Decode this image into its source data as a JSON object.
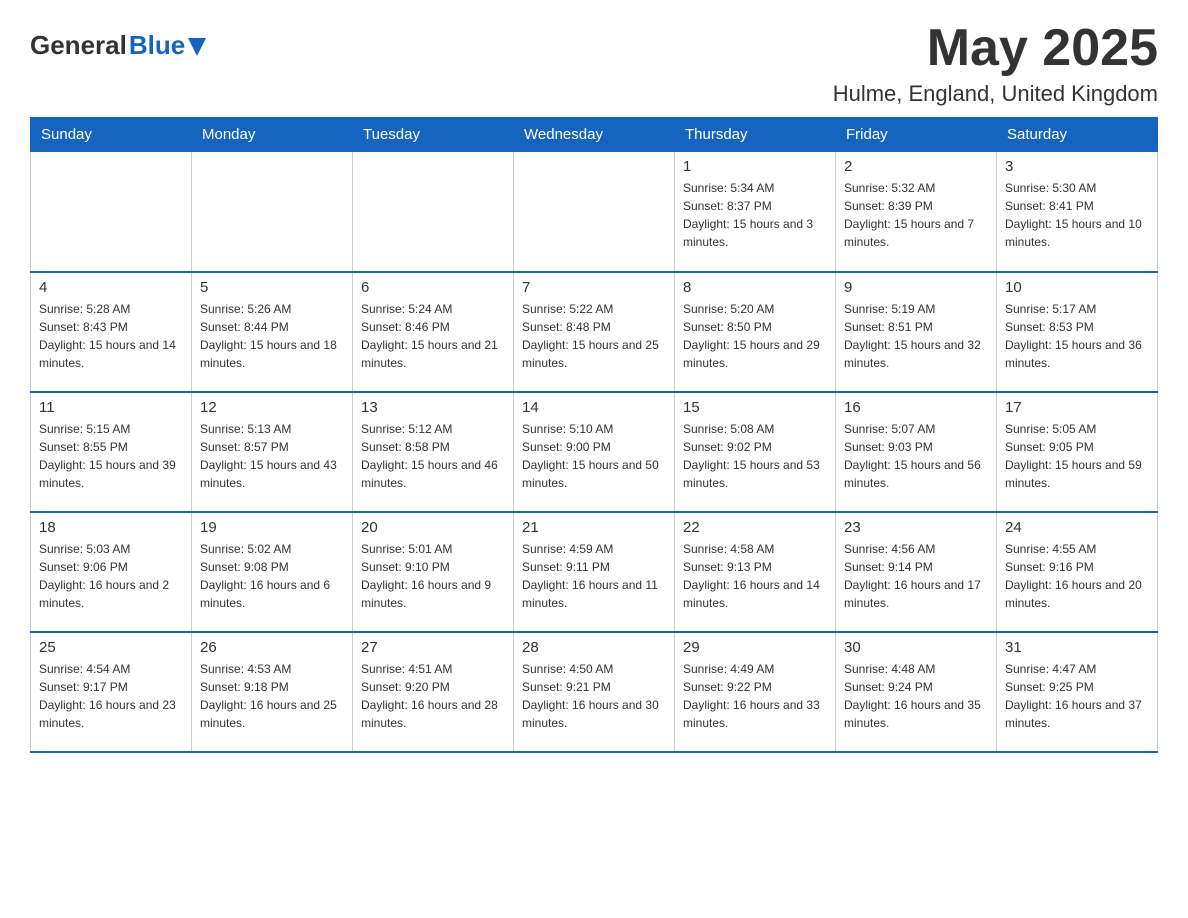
{
  "header": {
    "logo_general": "General",
    "logo_blue": "Blue",
    "title": "May 2025",
    "location": "Hulme, England, United Kingdom"
  },
  "weekdays": [
    "Sunday",
    "Monday",
    "Tuesday",
    "Wednesday",
    "Thursday",
    "Friday",
    "Saturday"
  ],
  "weeks": [
    [
      {
        "day": "",
        "info": ""
      },
      {
        "day": "",
        "info": ""
      },
      {
        "day": "",
        "info": ""
      },
      {
        "day": "",
        "info": ""
      },
      {
        "day": "1",
        "info": "Sunrise: 5:34 AM\nSunset: 8:37 PM\nDaylight: 15 hours and 3 minutes."
      },
      {
        "day": "2",
        "info": "Sunrise: 5:32 AM\nSunset: 8:39 PM\nDaylight: 15 hours and 7 minutes."
      },
      {
        "day": "3",
        "info": "Sunrise: 5:30 AM\nSunset: 8:41 PM\nDaylight: 15 hours and 10 minutes."
      }
    ],
    [
      {
        "day": "4",
        "info": "Sunrise: 5:28 AM\nSunset: 8:43 PM\nDaylight: 15 hours and 14 minutes."
      },
      {
        "day": "5",
        "info": "Sunrise: 5:26 AM\nSunset: 8:44 PM\nDaylight: 15 hours and 18 minutes."
      },
      {
        "day": "6",
        "info": "Sunrise: 5:24 AM\nSunset: 8:46 PM\nDaylight: 15 hours and 21 minutes."
      },
      {
        "day": "7",
        "info": "Sunrise: 5:22 AM\nSunset: 8:48 PM\nDaylight: 15 hours and 25 minutes."
      },
      {
        "day": "8",
        "info": "Sunrise: 5:20 AM\nSunset: 8:50 PM\nDaylight: 15 hours and 29 minutes."
      },
      {
        "day": "9",
        "info": "Sunrise: 5:19 AM\nSunset: 8:51 PM\nDaylight: 15 hours and 32 minutes."
      },
      {
        "day": "10",
        "info": "Sunrise: 5:17 AM\nSunset: 8:53 PM\nDaylight: 15 hours and 36 minutes."
      }
    ],
    [
      {
        "day": "11",
        "info": "Sunrise: 5:15 AM\nSunset: 8:55 PM\nDaylight: 15 hours and 39 minutes."
      },
      {
        "day": "12",
        "info": "Sunrise: 5:13 AM\nSunset: 8:57 PM\nDaylight: 15 hours and 43 minutes."
      },
      {
        "day": "13",
        "info": "Sunrise: 5:12 AM\nSunset: 8:58 PM\nDaylight: 15 hours and 46 minutes."
      },
      {
        "day": "14",
        "info": "Sunrise: 5:10 AM\nSunset: 9:00 PM\nDaylight: 15 hours and 50 minutes."
      },
      {
        "day": "15",
        "info": "Sunrise: 5:08 AM\nSunset: 9:02 PM\nDaylight: 15 hours and 53 minutes."
      },
      {
        "day": "16",
        "info": "Sunrise: 5:07 AM\nSunset: 9:03 PM\nDaylight: 15 hours and 56 minutes."
      },
      {
        "day": "17",
        "info": "Sunrise: 5:05 AM\nSunset: 9:05 PM\nDaylight: 15 hours and 59 minutes."
      }
    ],
    [
      {
        "day": "18",
        "info": "Sunrise: 5:03 AM\nSunset: 9:06 PM\nDaylight: 16 hours and 2 minutes."
      },
      {
        "day": "19",
        "info": "Sunrise: 5:02 AM\nSunset: 9:08 PM\nDaylight: 16 hours and 6 minutes."
      },
      {
        "day": "20",
        "info": "Sunrise: 5:01 AM\nSunset: 9:10 PM\nDaylight: 16 hours and 9 minutes."
      },
      {
        "day": "21",
        "info": "Sunrise: 4:59 AM\nSunset: 9:11 PM\nDaylight: 16 hours and 11 minutes."
      },
      {
        "day": "22",
        "info": "Sunrise: 4:58 AM\nSunset: 9:13 PM\nDaylight: 16 hours and 14 minutes."
      },
      {
        "day": "23",
        "info": "Sunrise: 4:56 AM\nSunset: 9:14 PM\nDaylight: 16 hours and 17 minutes."
      },
      {
        "day": "24",
        "info": "Sunrise: 4:55 AM\nSunset: 9:16 PM\nDaylight: 16 hours and 20 minutes."
      }
    ],
    [
      {
        "day": "25",
        "info": "Sunrise: 4:54 AM\nSunset: 9:17 PM\nDaylight: 16 hours and 23 minutes."
      },
      {
        "day": "26",
        "info": "Sunrise: 4:53 AM\nSunset: 9:18 PM\nDaylight: 16 hours and 25 minutes."
      },
      {
        "day": "27",
        "info": "Sunrise: 4:51 AM\nSunset: 9:20 PM\nDaylight: 16 hours and 28 minutes."
      },
      {
        "day": "28",
        "info": "Sunrise: 4:50 AM\nSunset: 9:21 PM\nDaylight: 16 hours and 30 minutes."
      },
      {
        "day": "29",
        "info": "Sunrise: 4:49 AM\nSunset: 9:22 PM\nDaylight: 16 hours and 33 minutes."
      },
      {
        "day": "30",
        "info": "Sunrise: 4:48 AM\nSunset: 9:24 PM\nDaylight: 16 hours and 35 minutes."
      },
      {
        "day": "31",
        "info": "Sunrise: 4:47 AM\nSunset: 9:25 PM\nDaylight: 16 hours and 37 minutes."
      }
    ]
  ]
}
